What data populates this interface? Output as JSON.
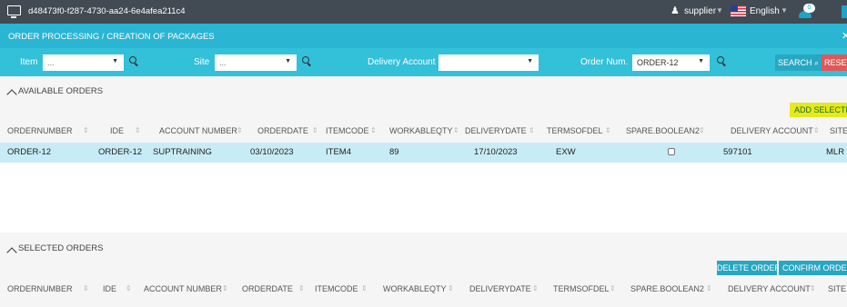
{
  "topbar": {
    "session_id": "d48473f0-f287-4730-aa24-6e4afea211c4",
    "user": "supplier",
    "language": "English",
    "notification_count": "0",
    "icons": [
      "monitor-icon",
      "user-icon",
      "flag-icon",
      "bell-icon"
    ]
  },
  "page": {
    "title": "ORDER PROCESSING / CREATION OF PACKAGES"
  },
  "filters": {
    "item_label": "Item",
    "item_value": "...",
    "site_label": "Site",
    "site_value": "...",
    "delivery_account_label": "Delivery Account",
    "delivery_account_value": "",
    "order_num_label": "Order Num.",
    "order_num_value": "ORDER-12",
    "search_label": "SEARCH",
    "reset_label": "RESET"
  },
  "available": {
    "title": "AVAILABLE ORDERS",
    "add_selected_label": "ADD SELECTED",
    "columns": [
      "ORDERNUMBER",
      "IDE",
      "ACCOUNT NUMBER",
      "ORDERDATE",
      "ITEMCODE",
      "WORKABLEQTY",
      "DELIVERYDATE",
      "TERMSOFDEL",
      "SPARE.BOOLEAN2",
      "DELIVERY ACCOUNT",
      "SITE"
    ],
    "rows": [
      {
        "ordernumber": "ORDER-12",
        "ide": "ORDER-12",
        "account_number": "SUPTRAINING",
        "orderdate": "03/10/2023",
        "itemcode": "ITEM4",
        "workableqty": "89",
        "deliverydate": "17/10/2023",
        "termsofdel": "EXW",
        "spare_boolean2": false,
        "delivery_account": "597101",
        "site": "MLR"
      }
    ]
  },
  "selected": {
    "title": "SELECTED ORDERS",
    "delete_label": "DELETE ORDER",
    "confirm_label": "CONFIRM ORDERS",
    "columns": [
      "ORDERNUMBER",
      "IDE",
      "ACCOUNT NUMBER",
      "ORDERDATE",
      "ITEMCODE",
      "WORKABLEQTY",
      "DELIVERYDATE",
      "TERMSOFDEL",
      "SPARE.BOOLEAN2",
      "DELIVERY ACCOUNT",
      "SITE"
    ]
  },
  "colors": {
    "topbar": "#424a53",
    "title_bar": "#2ab5d3",
    "filter_bar": "#33c0d9",
    "button": "#27a7c2",
    "reset": "#e15757",
    "highlight": "#e5ea18",
    "selected_row": "#c8ecf6"
  }
}
